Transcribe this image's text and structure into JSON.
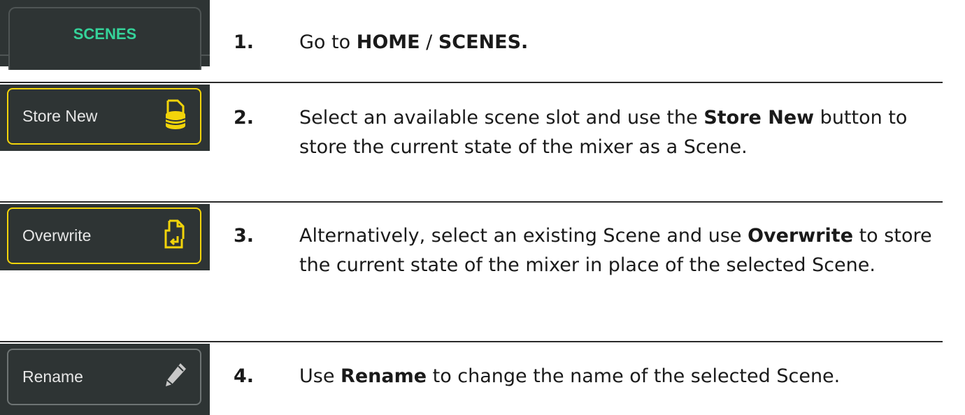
{
  "buttons": {
    "scenes_tab": "SCENES",
    "store_new": "Store New",
    "overwrite": "Overwrite",
    "rename": "Rename"
  },
  "steps": [
    {
      "number": "1.",
      "pre": "Go to ",
      "bold1": "HOME",
      "mid": " / ",
      "bold2": "SCENES."
    },
    {
      "number": "2.",
      "pre": "Select an available scene slot and use the ",
      "bold": "Store New",
      "post": " button to store the current state of the mixer as a Scene."
    },
    {
      "number": "3.",
      "pre": "Alternatively, select an existing Scene and use ",
      "bold": "Overwrite",
      "post": " to store the current state of the mixer in place of the selected Scene."
    },
    {
      "number": "4.",
      "pre": "Use ",
      "bold": "Rename",
      "post": " to change the name of the selected Scene."
    }
  ],
  "colors": {
    "panel": "#2e3434",
    "accent_yellow": "#f2d40a",
    "tab_text": "#35d39a",
    "border_grey": "#6e7474"
  },
  "icons": [
    "database-store-icon",
    "file-overwrite-icon",
    "pencil-icon"
  ]
}
